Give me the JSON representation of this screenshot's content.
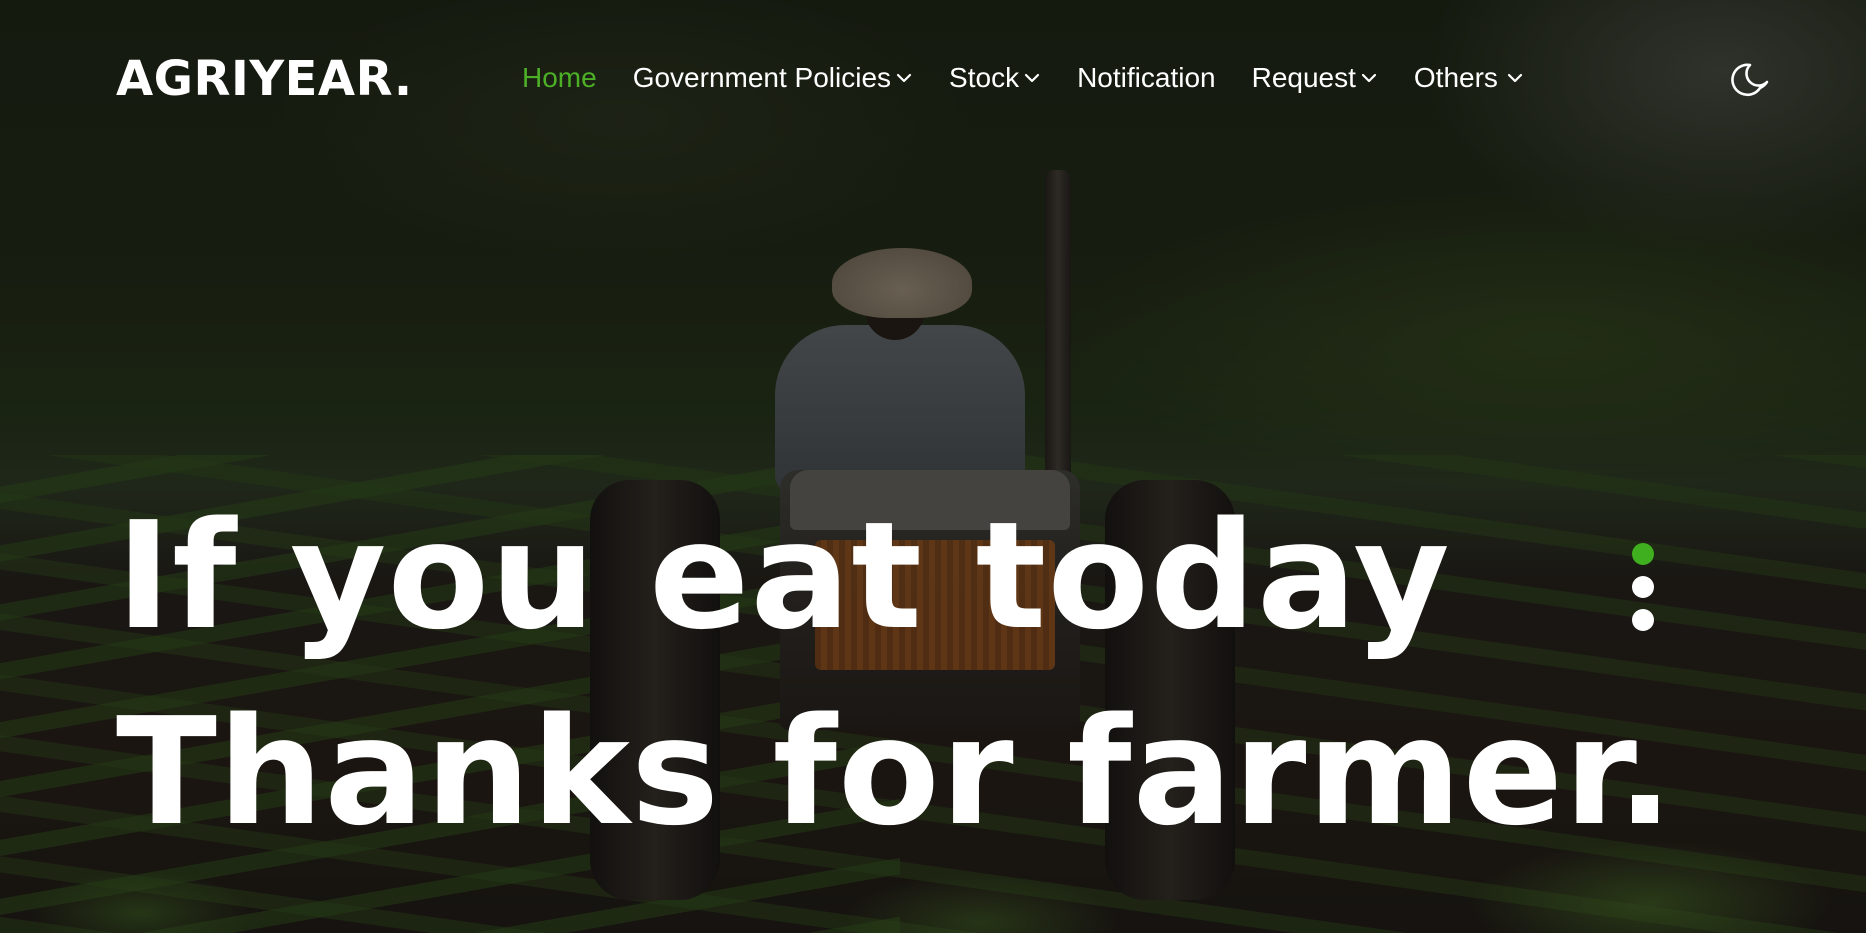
{
  "brand": {
    "logo_text": "AGRIYEAR."
  },
  "nav": {
    "items": [
      {
        "label": "Home",
        "active": true,
        "has_dropdown": false
      },
      {
        "label": "Government Policies",
        "active": false,
        "has_dropdown": true
      },
      {
        "label": "Stock",
        "active": false,
        "has_dropdown": true
      },
      {
        "label": "Notification",
        "active": false,
        "has_dropdown": false
      },
      {
        "label": "Request",
        "active": false,
        "has_dropdown": true
      },
      {
        "label": "Others",
        "active": false,
        "has_dropdown": true
      }
    ],
    "theme_toggle_icon": "moon-icon"
  },
  "hero": {
    "headline_line1": "If you eat today",
    "headline_line2": "Thanks for farmer.",
    "slider": {
      "count": 3,
      "active_index": 0
    }
  },
  "colors": {
    "accent": "#4caf26",
    "text": "#ffffff",
    "overlay": "rgba(0,0,0,0.38)"
  }
}
